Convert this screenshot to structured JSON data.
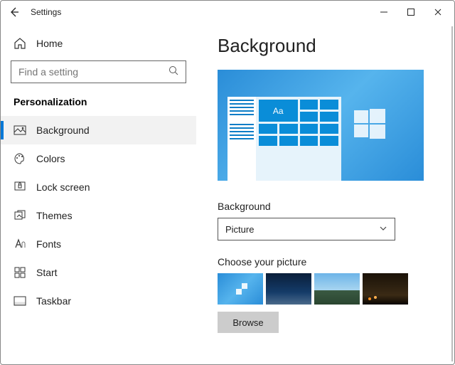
{
  "window": {
    "title": "Settings"
  },
  "sidebar": {
    "home_label": "Home",
    "search_placeholder": "Find a setting",
    "category": "Personalization",
    "items": [
      {
        "label": "Background",
        "active": true
      },
      {
        "label": "Colors"
      },
      {
        "label": "Lock screen"
      },
      {
        "label": "Themes"
      },
      {
        "label": "Fonts"
      },
      {
        "label": "Start"
      },
      {
        "label": "Taskbar"
      }
    ]
  },
  "page": {
    "heading": "Background",
    "preview_sample_text": "Aa",
    "bg_label": "Background",
    "bg_dropdown_value": "Picture",
    "choose_label": "Choose your picture",
    "browse_label": "Browse"
  }
}
